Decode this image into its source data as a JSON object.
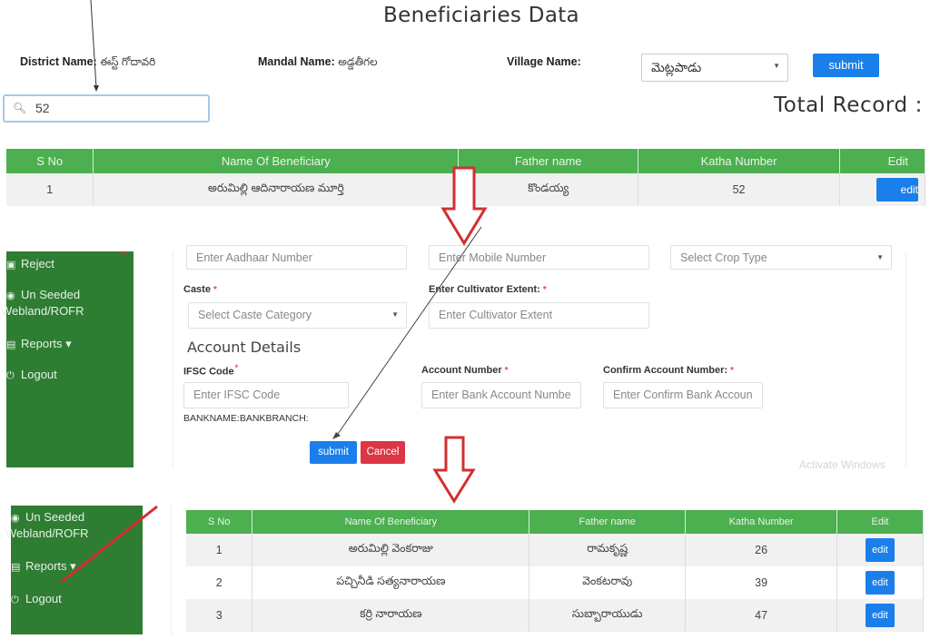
{
  "search_panel": {
    "title": "Beneficiaries Data",
    "district_label": "District Name:",
    "district_value": "ఈస్ట్ గోదావరి",
    "mandal_label": "Mandal Name:",
    "mandal_value": "అడ్డతీగల",
    "village_label": "Village Name:",
    "village_selected": "మెట్లపాడు",
    "submit_label": "submit",
    "search_value": "52",
    "total_record_label": "Total Record :",
    "table": {
      "headers": [
        "S No",
        "Name Of Beneficiary",
        "Father name",
        "Katha Number",
        "Edit"
      ],
      "rows": [
        {
          "sno": "1",
          "name": "అరుమిల్లి ఆదినారాయణ మూర్తి",
          "father": "కొండయ్య",
          "katha": "52",
          "edit": "edit"
        }
      ]
    }
  },
  "edit_form": {
    "sidebar": [
      {
        "icon": "list-icon",
        "glyph": "▣",
        "label": "Reject"
      },
      {
        "icon": "circle-icon",
        "glyph": "◉",
        "label": "Un Seeded"
      },
      {
        "icon": "",
        "glyph": "",
        "label": "Webland/ROFR"
      },
      {
        "icon": "report-icon",
        "glyph": "▤",
        "label": "Reports ▾"
      },
      {
        "icon": "power-icon",
        "glyph": "⏻",
        "label": "Logout"
      }
    ],
    "aadhaar_placeholder": "Enter Aadhaar Number",
    "mobile_placeholder": "Enter Mobile Number",
    "crop_type_placeholder": "Select Crop Type",
    "caste_label": "Caste",
    "caste_placeholder": "Select Caste Category",
    "cultivator_extent_label": "Enter Cultivator Extent:",
    "cultivator_extent_placeholder": "Enter Cultivator Extent",
    "account_section_title": "Account Details",
    "ifsc_label": "IFSC Code",
    "ifsc_placeholder": "Enter IFSC Code",
    "account_number_label": "Account Number",
    "account_number_placeholder": "Enter Bank Account Numbe",
    "confirm_account_label": "Confirm Account Number:",
    "confirm_account_placeholder": "Enter Confirm Bank Accoun",
    "bank_info": "BANKNAME:BANKBRANCH:",
    "submit_label": "submit",
    "cancel_label": "Cancel",
    "required_mark": "*",
    "watermark": "Activate Windows"
  },
  "results_panel": {
    "sidebar": [
      {
        "icon": "circle-icon",
        "glyph": "◉",
        "label": "Un Seeded"
      },
      {
        "icon": "",
        "glyph": "",
        "label": "Webland/ROFR"
      },
      {
        "icon": "report-icon",
        "glyph": "▤",
        "label": "Reports ▾"
      },
      {
        "icon": "power-icon",
        "glyph": "⏻",
        "label": "Logout"
      }
    ],
    "table": {
      "headers": [
        "S No",
        "Name Of Beneficiary",
        "Father name",
        "Katha Number",
        "Edit"
      ],
      "rows": [
        {
          "sno": "1",
          "name": "అరుమిల్లి వెంకరాజు",
          "father": "రామకృష్ణ",
          "katha": "26",
          "edit": "edit"
        },
        {
          "sno": "2",
          "name": "పచ్చినీడి సత్యనారాయణ",
          "father": "వెంకటరావు",
          "katha": "39",
          "edit": "edit"
        },
        {
          "sno": "3",
          "name": "కర్రి నారాయణ",
          "father": "సుబ్బారాయుడు",
          "katha": "47",
          "edit": "edit"
        }
      ]
    }
  },
  "colors": {
    "header_green": "#4caf50",
    "sidebar_green": "#2e7d32",
    "primary_blue": "#1a7fea",
    "danger_red": "#dc3545",
    "annotation_red": "#d32f2f"
  }
}
